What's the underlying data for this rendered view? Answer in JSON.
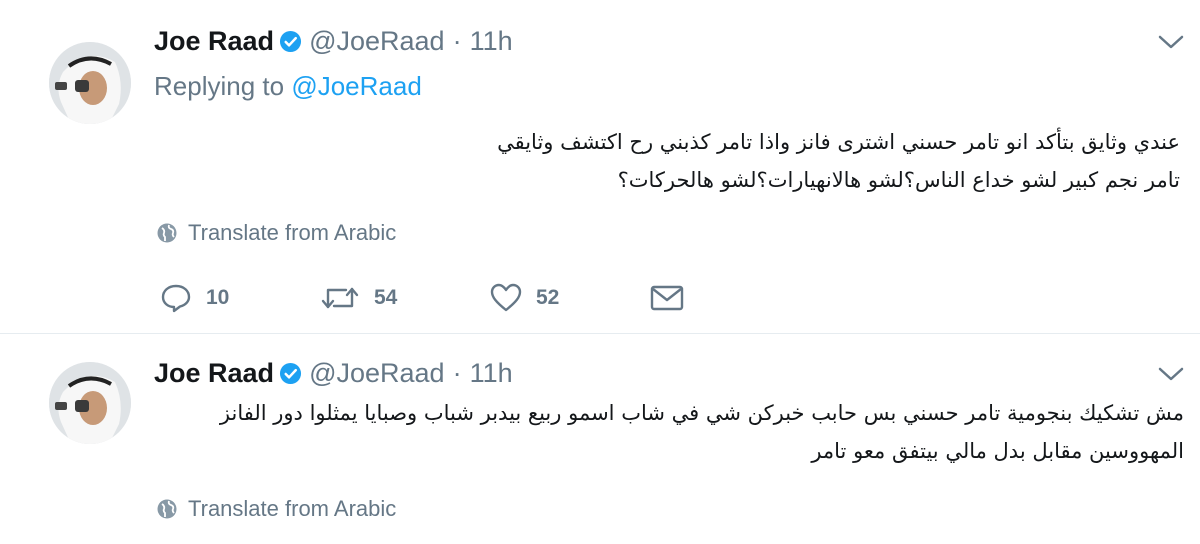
{
  "tweets": [
    {
      "name": "Joe Raad",
      "handle": "@JoeRaad",
      "separator": "·",
      "time": "11h",
      "replying_label": "Replying to",
      "replying_handle": "@JoeRaad",
      "lines": [
        "عندي وثايق بتأكد انو تامر حسني اشترى فانز واذا تامر كذبني رح اكتشف وثايقي",
        "تامر نجم كبير لشو خداع الناس؟لشو هالانهيارات؟لشو هالحركات؟"
      ],
      "translate_label": "Translate from Arabic",
      "actions": {
        "replies": "10",
        "retweets": "54",
        "likes": "52"
      }
    },
    {
      "name": "Joe Raad",
      "handle": "@JoeRaad",
      "separator": "·",
      "time": "11h",
      "lines": [
        "مش تشكيك بنجومية تامر حسني بس حابب خبركن شي في شاب اسمو ربيع بيدبر شباب وصبايا يمثلوا دور الفانز",
        "المهووسين مقابل بدل مالي بيتفق معو تامر"
      ],
      "translate_label": "Translate from Arabic"
    }
  ],
  "icons": {
    "verified": "verified-badge-icon",
    "menu": "chevron-down-icon",
    "translate": "globe-icon",
    "reply": "reply-bubble-icon",
    "retweet": "retweet-icon",
    "like": "heart-icon",
    "dm": "envelope-icon"
  },
  "colors": {
    "link": "#1da1f2",
    "muted": "#657786",
    "text": "#14171a",
    "divider": "#e6ecf0"
  }
}
